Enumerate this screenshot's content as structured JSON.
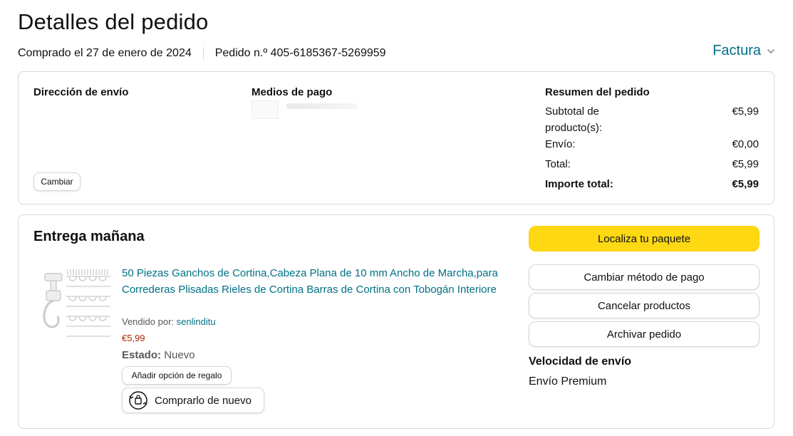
{
  "header": {
    "title": "Detalles del pedido",
    "purchased": "Comprado el 27 de enero de 2024",
    "order_number": "Pedido n.º 405-6185367-5269959",
    "invoice_label": "Factura",
    "invoice_icon": "chevron-down-icon"
  },
  "summary_box": {
    "shipping_address_heading": "Dirección de envío",
    "change_label": "Cambiar",
    "payment_heading": "Medios de pago",
    "order_summary_heading": "Resumen del pedido",
    "rows": [
      {
        "label": "Subtotal de producto(s):",
        "value": "€5,99"
      },
      {
        "label": "Envío:",
        "value": "€0,00"
      },
      {
        "label": "Total:",
        "value": "€5,99"
      },
      {
        "label": "Importe total:",
        "value": "€5,99"
      }
    ]
  },
  "delivery": {
    "heading": "Entrega mañana",
    "product_title": "50 Piezas Ganchos de Cortina,Cabeza Plana de 10 mm Ancho de Marcha,para Correderas Plisadas Rieles de Cortina Barras de Cortina con Tobogán Interiore",
    "sold_by_label": "Vendido por:",
    "seller": "senlinditu",
    "price": "€5,99",
    "state_label": "Estado:",
    "state_value": "Nuevo",
    "gift_button": "Añadir opción de regalo",
    "buy_again_button": "Comprarlo de nuevo",
    "actions": {
      "track": "Localiza tu paquete",
      "change_payment": "Cambiar método de pago",
      "cancel": "Cancelar productos",
      "archive": "Archivar pedido"
    },
    "shipping_speed_heading": "Velocidad de envío",
    "shipping_speed_value": "Envío Premium"
  },
  "colors": {
    "link": "#007185",
    "price": "#b12704",
    "primary_button": "#ffd814",
    "border": "#d5d9d9"
  }
}
